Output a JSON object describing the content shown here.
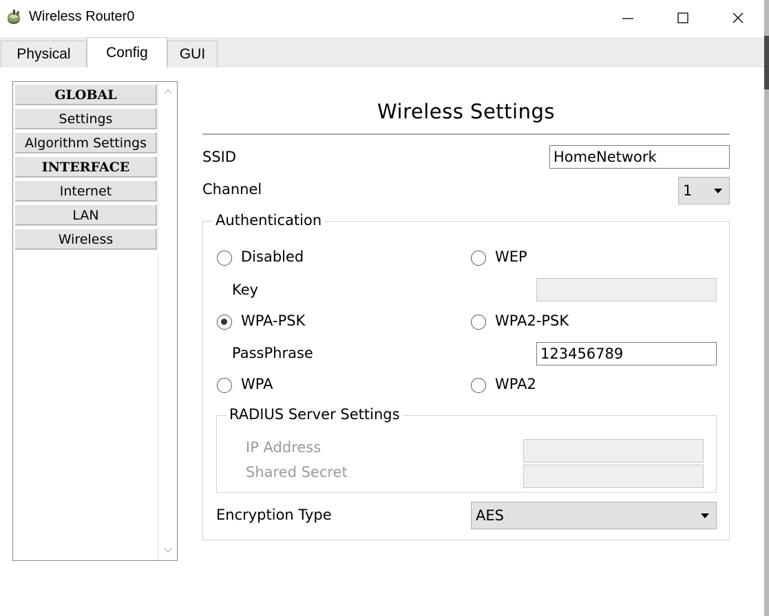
{
  "window": {
    "title": "Wireless Router0",
    "icon": "router-icon",
    "controls": {
      "minimize": "minimize-icon",
      "maximize": "maximize-icon",
      "close": "close-icon"
    }
  },
  "tabs": [
    {
      "label": "Physical",
      "active": false
    },
    {
      "label": "Config",
      "active": true
    },
    {
      "label": "GUI",
      "active": false
    }
  ],
  "sidebar": {
    "items": [
      {
        "label": "GLOBAL",
        "type": "header"
      },
      {
        "label": "Settings",
        "type": "item"
      },
      {
        "label": "Algorithm Settings",
        "type": "item"
      },
      {
        "label": "INTERFACE",
        "type": "header"
      },
      {
        "label": "Internet",
        "type": "item"
      },
      {
        "label": "LAN",
        "type": "item"
      },
      {
        "label": "Wireless",
        "type": "item"
      }
    ]
  },
  "main": {
    "title": "Wireless Settings",
    "ssid_label": "SSID",
    "ssid_value": "HomeNetwork",
    "channel_label": "Channel",
    "channel_value": "1",
    "auth": {
      "legend": "Authentication",
      "disabled_label": "Disabled",
      "wep_label": "WEP",
      "key_label": "Key",
      "key_value": "",
      "wpa_psk_label": "WPA-PSK",
      "wpa2_psk_label": "WPA2-PSK",
      "passphrase_label": "PassPhrase",
      "passphrase_value": "123456789",
      "wpa_label": "WPA",
      "wpa2_label": "WPA2",
      "selected": "WPA-PSK",
      "radius": {
        "legend": "RADIUS Server Settings",
        "ip_label": "IP Address",
        "ip_value": "",
        "secret_label": "Shared Secret",
        "secret_value": ""
      },
      "encryption_label": "Encryption Type",
      "encryption_value": "AES"
    }
  }
}
